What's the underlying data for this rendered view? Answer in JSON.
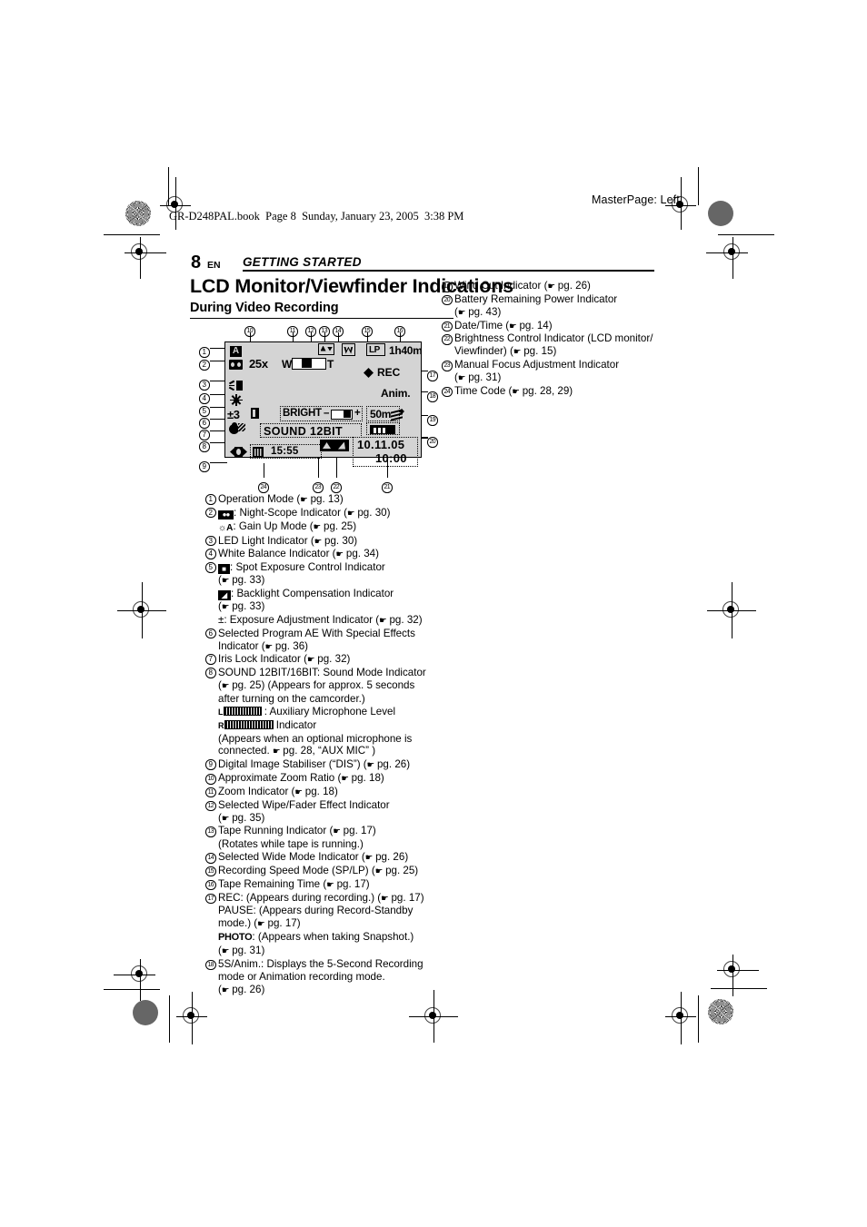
{
  "page": {
    "masterpage": "MasterPage: Left",
    "bookline": "GR-D248PAL.book  Page 8  Sunday, January 23, 2005  3:38 PM",
    "number": "8",
    "lang": "EN",
    "chapter": "GETTING STARTED",
    "title": "LCD Monitor/Viewfinder Indications",
    "subtitle": "During Video Recording"
  },
  "lcd": {
    "operation_mode_icon": "A",
    "night_scope_icon": "night-scope",
    "led_light_icon": "led-light",
    "white_balance_icon": "white-balance-sun",
    "exposure_value": "±3",
    "iris_lock_icon": "iris-lock",
    "program_ae_icon": "program-ae-sports",
    "zoom_ratio": "25x",
    "zoom_w": "W",
    "zoom_t": "T",
    "fader_icon": "wipe-fader",
    "wide_mode_icon": "W",
    "speed_mode": "LP",
    "tape_remaining": "1h40m",
    "rec_label": "REC",
    "anim_label": "Anim.",
    "wind_cut_icon": "wind-cut",
    "bright_label": "BRIGHT",
    "bright_minus": "–",
    "bright_plus": "+",
    "focus_distance": "50m",
    "battery_icon": "battery",
    "sound_mode": "SOUND 12BIT",
    "date": "10.11.05",
    "time": "10:00",
    "time_code": "15:55",
    "tape_running_icon": "tape-running",
    "mic_level_icon": "mic-level",
    "manual_focus_icon": "manual-focus",
    "callouts_top": [
      "10",
      "11",
      "12",
      "13",
      "14",
      "15",
      "16"
    ],
    "callouts_left": [
      "1",
      "2",
      "3",
      "4",
      "5",
      "6",
      "7",
      "8",
      "9"
    ],
    "callouts_right": [
      "17",
      "18",
      "19",
      "20"
    ],
    "callouts_bottom": [
      "24",
      "23",
      "22",
      "21"
    ]
  },
  "list_left": [
    {
      "num": "1",
      "lines": [
        "Operation Mode (@ pg. 13)"
      ]
    },
    {
      "num": "2",
      "lines": [
        "[NIGHT]: Night-Scope Indicator (@ pg. 30)",
        "[GAIN]: Gain Up Mode (@ pg. 25)"
      ]
    },
    {
      "num": "3",
      "lines": [
        "LED Light Indicator (@ pg. 30)"
      ]
    },
    {
      "num": "4",
      "lines": [
        "White Balance Indicator (@ pg. 34)"
      ]
    },
    {
      "num": "5",
      "lines": [
        "[SPOT]: Spot Exposure Control Indicator",
        "(@ pg. 33)",
        "[BACK]: Backlight Compensation Indicator",
        "(@ pg. 33)",
        "±: Exposure Adjustment Indicator (@ pg. 32)"
      ]
    },
    {
      "num": "6",
      "lines": [
        "Selected Program AE With Special Effects",
        "Indicator (@ pg. 36)"
      ]
    },
    {
      "num": "7",
      "lines": [
        "Iris Lock Indicator (@ pg. 32)"
      ]
    },
    {
      "num": "8",
      "lines": [
        "SOUND 12BIT/16BIT: Sound Mode Indicator",
        "(@ pg. 25) (Appears for approx. 5 seconds",
        "after turning on the camcorder.)",
        "[METER-L] : Auxiliary Microphone Level",
        "[METER-R]  Indicator",
        "(Appears when an optional microphone is",
        "connected. @ pg. 28, “AUX MIC” )"
      ]
    },
    {
      "num": "9",
      "lines": [
        "Digital Image Stabiliser (“DIS”) (@ pg. 26)"
      ]
    },
    {
      "num": "10",
      "lines": [
        "Approximate Zoom Ratio (@ pg. 18)"
      ]
    },
    {
      "num": "11",
      "lines": [
        "Zoom Indicator (@ pg. 18)"
      ]
    },
    {
      "num": "12",
      "lines": [
        "Selected Wipe/Fader Effect Indicator",
        "(@ pg. 35)"
      ]
    },
    {
      "num": "13",
      "lines": [
        "Tape Running Indicator (@ pg. 17)",
        "(Rotates while tape is running.)"
      ]
    },
    {
      "num": "14",
      "lines": [
        "Selected Wide Mode Indicator (@ pg. 26)"
      ]
    },
    {
      "num": "15",
      "lines": [
        "Recording Speed Mode (SP/LP) (@ pg. 25)"
      ]
    },
    {
      "num": "16",
      "lines": [
        "Tape Remaining Time (@ pg. 17)"
      ]
    },
    {
      "num": "17",
      "lines": [
        "REC: (Appears during recording.) (@ pg. 17)",
        "PAUSE: (Appears during Record-Standby",
        "mode.) (@ pg. 17)",
        "[PHOTO]: (Appears when taking Snapshot.)",
        "(@ pg. 31)"
      ]
    },
    {
      "num": "18",
      "lines": [
        "5S/Anim.: Displays the 5-Second Recording",
        "mode or Animation recording mode.",
        "(@ pg. 26)"
      ]
    }
  ],
  "list_right": [
    {
      "num": "19",
      "lines": [
        "Wind Cut Indicator (@ pg. 26)"
      ]
    },
    {
      "num": "20",
      "lines": [
        "Battery Remaining Power Indicator",
        "(@ pg. 43)"
      ]
    },
    {
      "num": "21",
      "lines": [
        "Date/Time (@ pg. 14)"
      ]
    },
    {
      "num": "22",
      "lines": [
        "Brightness Control Indicator (LCD monitor/",
        "Viewfinder) (@ pg. 15)"
      ]
    },
    {
      "num": "23",
      "lines": [
        "Manual Focus Adjustment Indicator",
        "(@ pg. 31)"
      ]
    },
    {
      "num": "24",
      "lines": [
        "Time Code (@ pg. 28, 29)"
      ]
    }
  ]
}
